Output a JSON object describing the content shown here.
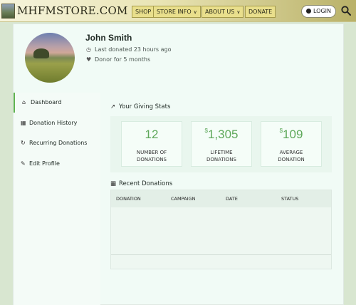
{
  "header": {
    "logo_text": "MHFMSTORE.COM",
    "nav": [
      {
        "label": "SHOP",
        "has_menu": false
      },
      {
        "label": "STORE INFO",
        "has_menu": true
      },
      {
        "label": "ABOUT US",
        "has_menu": true
      },
      {
        "label": "DONATE",
        "has_menu": false
      }
    ],
    "login_label": "LOGIN"
  },
  "profile": {
    "name": "John Smith",
    "last_donated": "Last donated 23 hours ago",
    "donor_for": "Donor for 5 months"
  },
  "sidebar": {
    "items": [
      {
        "label": "Dashboard",
        "icon": "home-icon",
        "active": true
      },
      {
        "label": "Donation History",
        "icon": "calendar-icon",
        "active": false
      },
      {
        "label": "Recurring Donations",
        "icon": "refresh-icon",
        "active": false
      },
      {
        "label": "Edit Profile",
        "icon": "pencil-icon",
        "active": false
      }
    ]
  },
  "stats": {
    "title": "Your Giving Stats",
    "items": [
      {
        "prefix": "",
        "value": "12",
        "label_line1": "NUMBER OF",
        "label_line2": "DONATIONS"
      },
      {
        "prefix": "$",
        "value": "1,305",
        "label_line1": "LIFETIME",
        "label_line2": "DONATIONS"
      },
      {
        "prefix": "$",
        "value": "109",
        "label_line1": "AVERAGE",
        "label_line2": "DONATION"
      }
    ]
  },
  "recent": {
    "title": "Recent Donations",
    "columns": [
      "DONATION",
      "CAMPAIGN",
      "DATE",
      "STATUS"
    ]
  },
  "colors": {
    "accent": "#5ea85a",
    "nav_button": "#e9df8c"
  }
}
